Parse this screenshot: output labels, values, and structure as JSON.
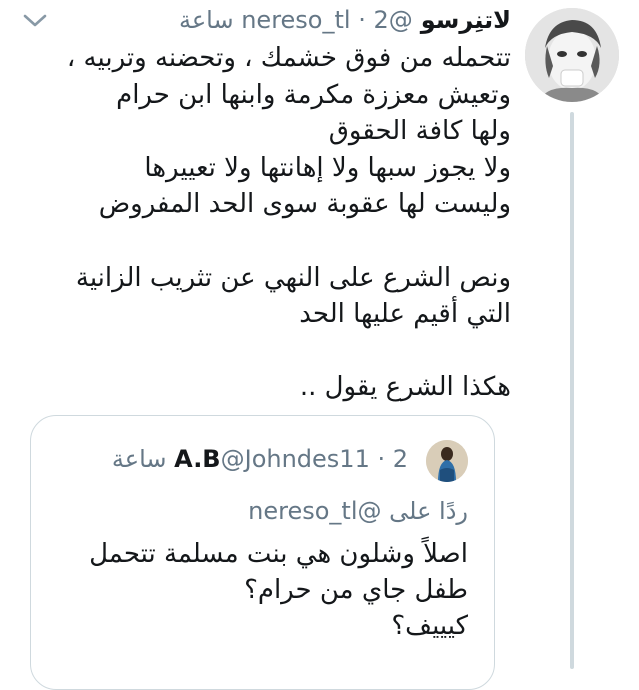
{
  "tweet": {
    "display_name": "لاتنِرسو",
    "meta": "@nereso_tl · 2 ساعة",
    "lines": [
      "تتحمله من فوق خشمك ، وتحضنه وتربيه ،",
      "وتعيش معززة مكرمة وابنها ابن حرام",
      "ولها كافة الحقوق",
      "ولا يجوز سبها ولا إهانتها ولا تعييرها",
      "وليست لها عقوبة سوى الحد المفروض",
      "",
      "ونص الشرع على النهي عن تثريب الزانية",
      "التي أقيم عليها الحد",
      "",
      "هكذا الشرع يقول .."
    ],
    "icons": {
      "avatar": "profile-avatar",
      "menu": "chevron-down-icon"
    }
  },
  "quoted_tweet": {
    "display_name": "A.B",
    "meta": "@Johndes11 · 2 ساعة",
    "reply_to": "ردًا على @nereso_tl",
    "lines": [
      "اصلاً وشلون هي بنت مسلمة تتحمل",
      "طفل جاي من حرام؟",
      "كيييف؟"
    ]
  },
  "colors": {
    "text": "#14171a",
    "secondary": "#657786",
    "border": "#cfd9de"
  }
}
